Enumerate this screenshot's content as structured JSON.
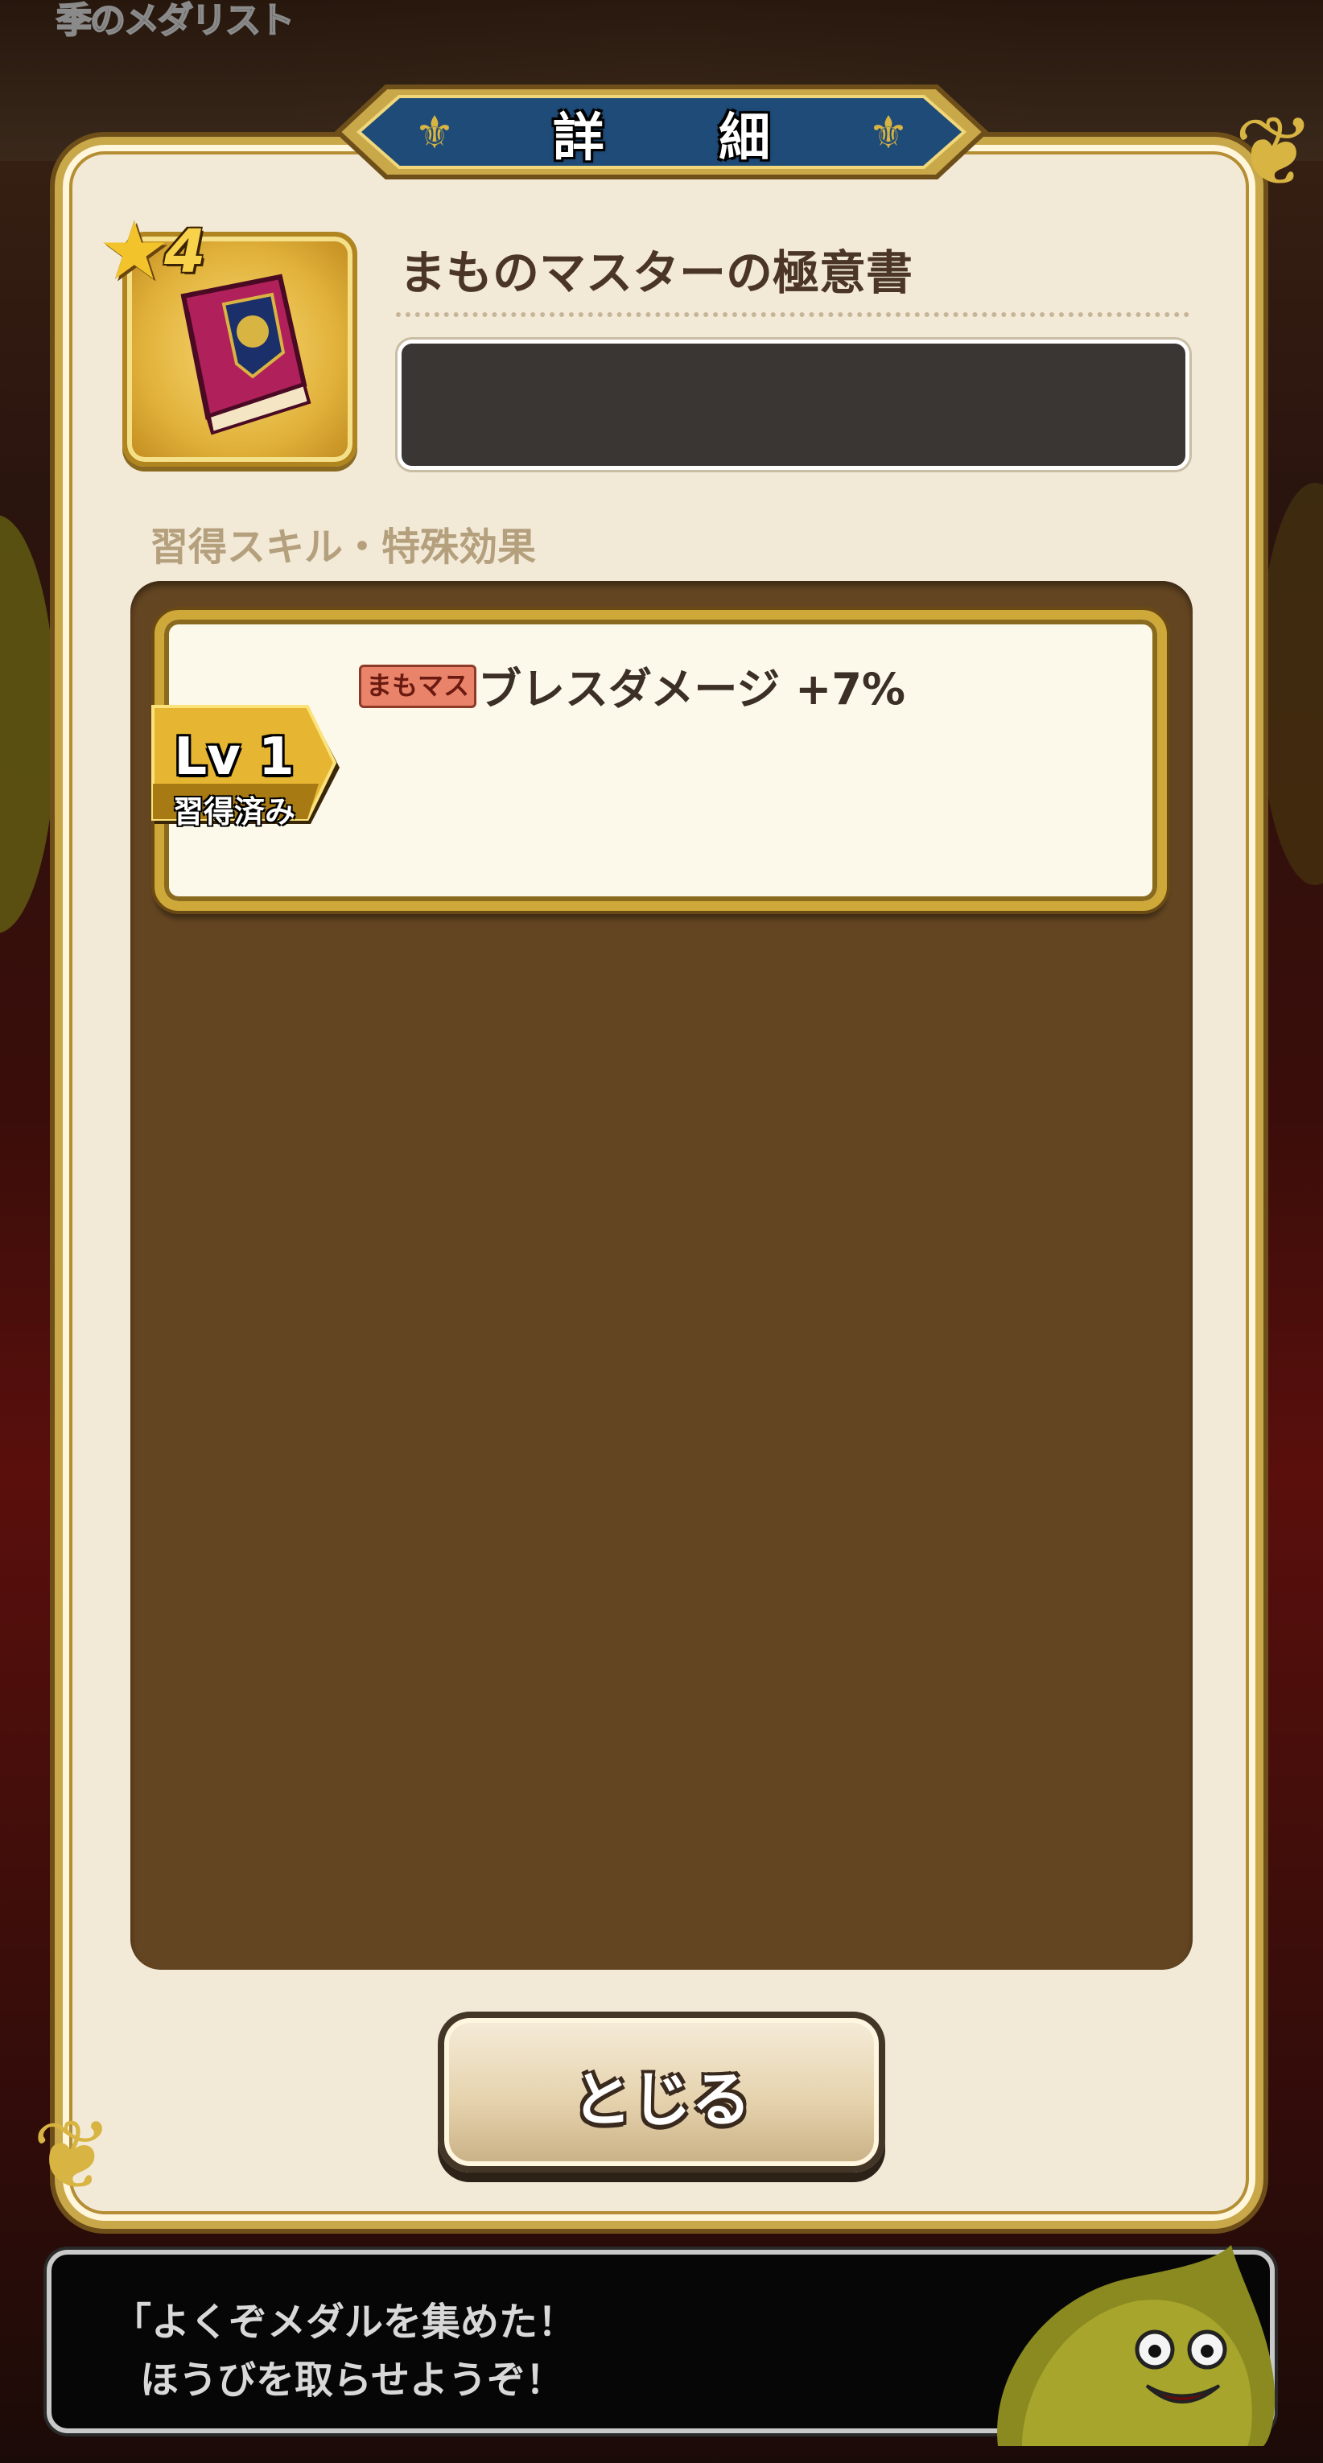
{
  "background": {
    "label": "季のメダリスト"
  },
  "dialog": {
    "title": "詳 細",
    "item": {
      "rarity_stars": "4",
      "name": "まものマスターの極意書",
      "icon": "spellbook-icon"
    },
    "section_label": "習得スキル・特殊効果",
    "skills": [
      {
        "level": "Lv 1",
        "status": "習得済み",
        "tag": "まもマス",
        "text": "ブレスダメージ +7%"
      }
    ],
    "close_label": "とじる"
  },
  "dialogue": {
    "line1": "「よくぞメダルを集めた！",
    "line2": "ほうびを取らせようぞ！"
  },
  "colors": {
    "gold": "#cfa83a",
    "panel": "#f2e9d7",
    "skill_list_bg": "#634521",
    "banner_blue": "#1f4b78"
  }
}
